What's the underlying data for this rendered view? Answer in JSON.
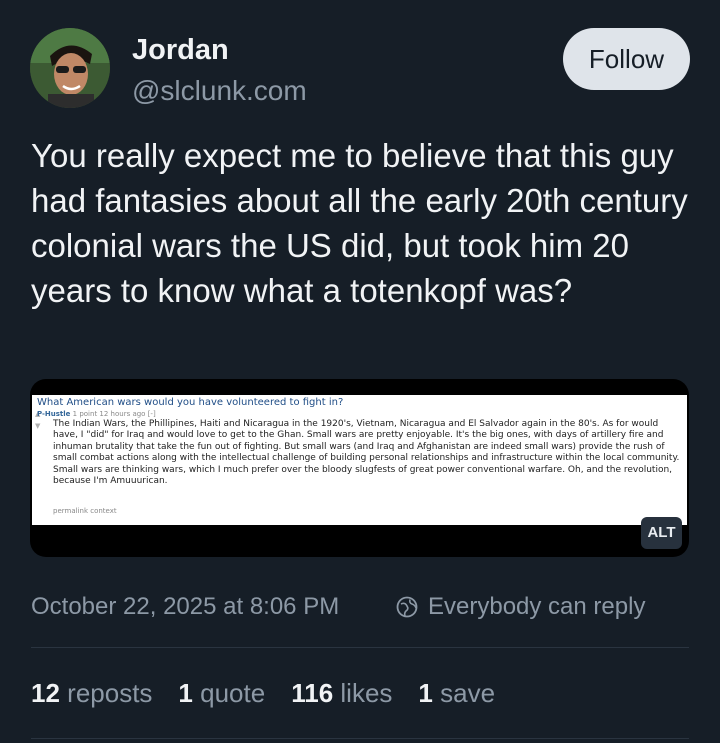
{
  "author": {
    "name": "Jordan",
    "handle": "@slclunk.com",
    "follow_label": "Follow"
  },
  "post": {
    "text": "You really expect me to believe that this guy had fantasies about all the early 20th century colonial wars the US did, but took him 20 years to know what a totenkopf was?",
    "timestamp": "October 22, 2025 at 8:06 PM",
    "reply_setting": "Everybody can reply"
  },
  "embed": {
    "alt_badge": "ALT",
    "screenshot": {
      "question": "What American wars would you have volunteered to fight in?",
      "user": "P-Hustle",
      "meta": "1 point 12 hours ago [-]",
      "body": "The Indian Wars, the Phillipines, Haiti and Nicaragua in the 1920's, Vietnam, Nicaragua and El Salvador again in the 80's. As for would have, I \"did\" for Iraq and would love to get to the Ghan. Small wars are pretty enjoyable. It's the big ones, with days of artillery fire and inhuman brutality that take the fun out of fighting. But small wars (and Iraq and Afghanistan are indeed small wars) provide the rush of small combat actions along with the intellectual challenge of building personal relationships and infrastructure within the local community. Small wars are thinking wars, which I much prefer over the bloody slugfests of great power conventional warfare. Oh, and the revolution, because I'm Amuuurican.",
      "links": "permalink   context"
    }
  },
  "stats": {
    "reposts": {
      "count": "12",
      "label": "reposts"
    },
    "quotes": {
      "count": "1",
      "label": "quote"
    },
    "likes": {
      "count": "116",
      "label": "likes"
    },
    "saves": {
      "count": "1",
      "label": "save"
    }
  },
  "colors": {
    "background": "#161e27",
    "muted_text": "#8d99a6",
    "follow_button": "#dfe4ea"
  }
}
